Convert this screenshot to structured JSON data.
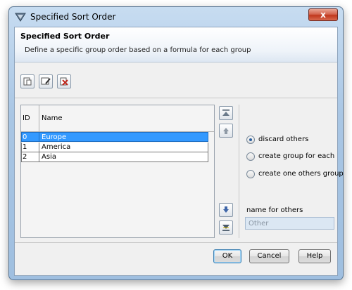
{
  "window": {
    "title": "Specified Sort Order",
    "close_glyph": "x"
  },
  "header": {
    "title": "Specified Sort Order",
    "description": "Define a specific group order based on a formula for each group"
  },
  "toolbar": {
    "buttons": [
      {
        "icon": "new-document-icon"
      },
      {
        "icon": "edit-formula-icon"
      },
      {
        "icon": "delete-icon"
      }
    ]
  },
  "table": {
    "columns": [
      "ID",
      "Name"
    ],
    "rows": [
      {
        "id": "0",
        "name": "Europe",
        "selected": true
      },
      {
        "id": "1",
        "name": "America",
        "selected": false
      },
      {
        "id": "2",
        "name": "Asia",
        "selected": false
      }
    ]
  },
  "move_buttons": [
    "move-to-top-icon",
    "move-up-icon",
    "move-down-icon",
    "move-to-bottom-icon"
  ],
  "options": {
    "radios": [
      {
        "label": "discard others",
        "checked": true
      },
      {
        "label": "create group for each",
        "checked": false
      },
      {
        "label": "create one others group",
        "checked": false
      }
    ],
    "others_label": "name for others",
    "others_value": "Other"
  },
  "buttons": {
    "ok": "OK",
    "cancel": "Cancel",
    "help": "Help"
  },
  "colors": {
    "selection": "#3399ff",
    "header_bg": "#ffffff",
    "dialog_bg": "#f0f0f0"
  }
}
